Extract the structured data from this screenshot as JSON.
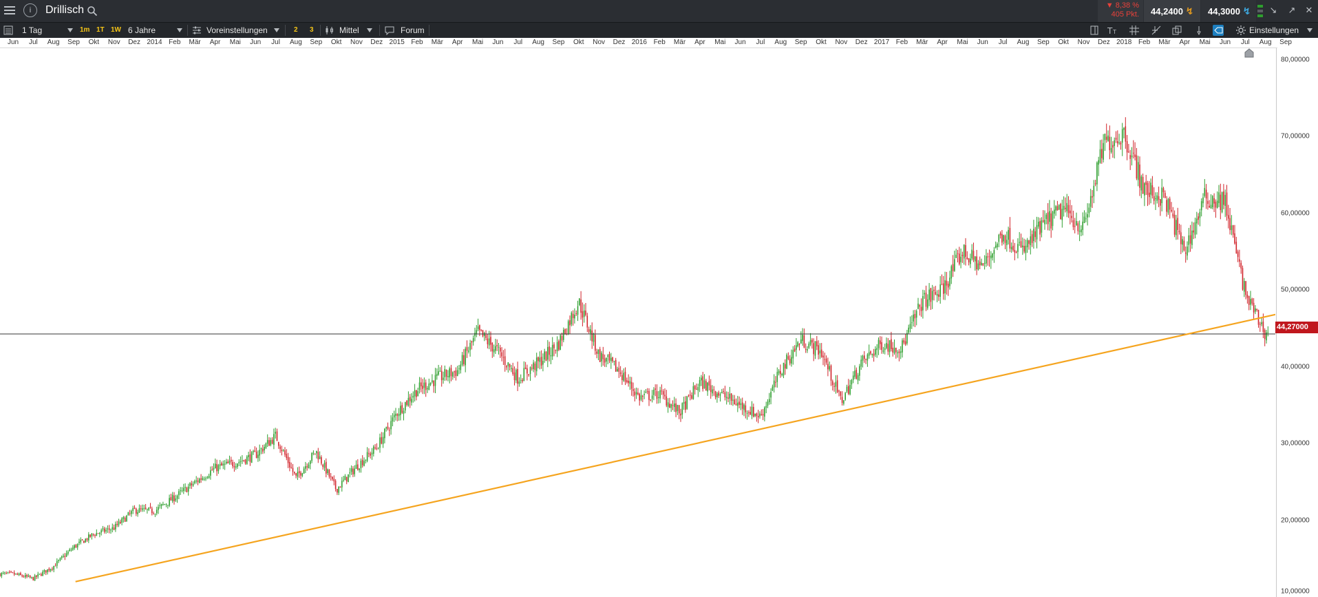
{
  "header": {
    "instrument": "Drillisch",
    "change_pct": "▼ 8,38 %",
    "change_pts": "405 Pkt.",
    "bid": "44,2400",
    "ask": "44,3000",
    "info_label": "i",
    "icons": [
      "menu-icon",
      "info-icon",
      "search-icon",
      "collapse-icon",
      "popout-icon",
      "close-icon"
    ]
  },
  "toolbar": {
    "interval": "1 Tag",
    "quick_1m": "1m",
    "quick_1t": "1T",
    "quick_1w": "1W",
    "range": "6 Jahre",
    "presets": "Voreinstellungen",
    "btn_2": "2",
    "btn_3": "3",
    "chart_style": "Mittel",
    "forum": "Forum",
    "settings": "Einstellungen"
  },
  "chart_data": {
    "type": "candlestick",
    "x_axis_labels": [
      "Jun",
      "Jul",
      "Aug",
      "Sep",
      "Okt",
      "Nov",
      "Dez",
      "2014",
      "Feb",
      "Mär",
      "Apr",
      "Mai",
      "Jun",
      "Jul",
      "Aug",
      "Sep",
      "Okt",
      "Nov",
      "Dez",
      "2015",
      "Feb",
      "Mär",
      "Apr",
      "Mai",
      "Jun",
      "Jul",
      "Aug",
      "Sep",
      "Okt",
      "Nov",
      "Dez",
      "2016",
      "Feb",
      "Mär",
      "Apr",
      "Mai",
      "Jun",
      "Jul",
      "Aug",
      "Sep",
      "Okt",
      "Nov",
      "Dez",
      "2017",
      "Feb",
      "Mär",
      "Apr",
      "Mai",
      "Jun",
      "Jul",
      "Aug",
      "Sep",
      "Okt",
      "Nov",
      "Dez",
      "2018",
      "Feb",
      "Mär",
      "Apr",
      "Mai",
      "Jun",
      "Jul",
      "Aug",
      "Sep"
    ],
    "y_tick_labels": [
      "80,00000",
      "70,00000",
      "60,00000",
      "50,00000",
      "40,00000",
      "30,00000",
      "20,00000",
      "10,00000"
    ],
    "y_ticks": [
      80,
      70,
      60,
      50,
      40,
      30,
      20,
      10
    ],
    "ylim": [
      10,
      81.5
    ],
    "current_price": 44.27,
    "current_price_label": "44,27000",
    "trendline": {
      "from": {
        "x": "2013-08",
        "y": 12.0
      },
      "to": {
        "x": "2018-09",
        "y": 46.8
      }
    },
    "trend_color": "#f5a41e",
    "up_color": "#2e9e2e",
    "down_color": "#d1232a",
    "series_path": [
      {
        "x": "2013-06",
        "y": 13.0
      },
      {
        "x": "2013-07",
        "y": 12.4
      },
      {
        "x": "2013-08",
        "y": 14.0
      },
      {
        "x": "2013-09",
        "y": 16.5
      },
      {
        "x": "2013-10",
        "y": 18.2
      },
      {
        "x": "2013-11",
        "y": 19.0
      },
      {
        "x": "2013-12",
        "y": 21.3
      },
      {
        "x": "2014-01",
        "y": 21.2
      },
      {
        "x": "2014-02",
        "y": 23.0
      },
      {
        "x": "2014-03",
        "y": 24.9
      },
      {
        "x": "2014-04",
        "y": 26.8
      },
      {
        "x": "2014-05",
        "y": 27.5
      },
      {
        "x": "2014-06",
        "y": 28.5
      },
      {
        "x": "2014-07",
        "y": 31.0
      },
      {
        "x": "2014-08",
        "y": 25.5
      },
      {
        "x": "2014-09",
        "y": 29.0
      },
      {
        "x": "2014-10",
        "y": 24.0
      },
      {
        "x": "2014-11",
        "y": 27.0
      },
      {
        "x": "2014-12",
        "y": 29.5
      },
      {
        "x": "2015-01",
        "y": 34.0
      },
      {
        "x": "2015-02",
        "y": 37.0
      },
      {
        "x": "2015-03",
        "y": 38.5
      },
      {
        "x": "2015-04",
        "y": 39.5
      },
      {
        "x": "2015-05",
        "y": 44.5
      },
      {
        "x": "2015-06",
        "y": 42.0
      },
      {
        "x": "2015-07",
        "y": 38.5
      },
      {
        "x": "2015-08",
        "y": 40.5
      },
      {
        "x": "2015-09",
        "y": 43.0
      },
      {
        "x": "2015-10",
        "y": 48.5
      },
      {
        "x": "2015-11",
        "y": 41.5
      },
      {
        "x": "2015-12",
        "y": 39.5
      },
      {
        "x": "2016-01",
        "y": 36.0
      },
      {
        "x": "2016-02",
        "y": 36.5
      },
      {
        "x": "2016-03",
        "y": 34.0
      },
      {
        "x": "2016-04",
        "y": 38.0
      },
      {
        "x": "2016-05",
        "y": 36.5
      },
      {
        "x": "2016-06",
        "y": 35.0
      },
      {
        "x": "2016-07",
        "y": 33.5
      },
      {
        "x": "2016-08",
        "y": 39.5
      },
      {
        "x": "2016-09",
        "y": 43.5
      },
      {
        "x": "2016-10",
        "y": 42.0
      },
      {
        "x": "2016-11",
        "y": 35.5
      },
      {
        "x": "2016-12",
        "y": 40.5
      },
      {
        "x": "2017-01",
        "y": 43.0
      },
      {
        "x": "2017-02",
        "y": 42.5
      },
      {
        "x": "2017-03",
        "y": 48.5
      },
      {
        "x": "2017-04",
        "y": 50.0
      },
      {
        "x": "2017-05",
        "y": 55.0
      },
      {
        "x": "2017-06",
        "y": 53.0
      },
      {
        "x": "2017-07",
        "y": 57.5
      },
      {
        "x": "2017-08",
        "y": 55.0
      },
      {
        "x": "2017-09",
        "y": 58.5
      },
      {
        "x": "2017-10",
        "y": 60.5
      },
      {
        "x": "2017-11",
        "y": 58.0
      },
      {
        "x": "2017-12",
        "y": 69.0
      },
      {
        "x": "2018-01",
        "y": 70.5
      },
      {
        "x": "2018-02",
        "y": 63.0
      },
      {
        "x": "2018-03",
        "y": 62.0
      },
      {
        "x": "2018-04",
        "y": 55.0
      },
      {
        "x": "2018-05",
        "y": 62.0
      },
      {
        "x": "2018-06",
        "y": 61.5
      },
      {
        "x": "2018-07",
        "y": 49.5
      },
      {
        "x": "2018-08",
        "y": 44.3
      }
    ]
  }
}
